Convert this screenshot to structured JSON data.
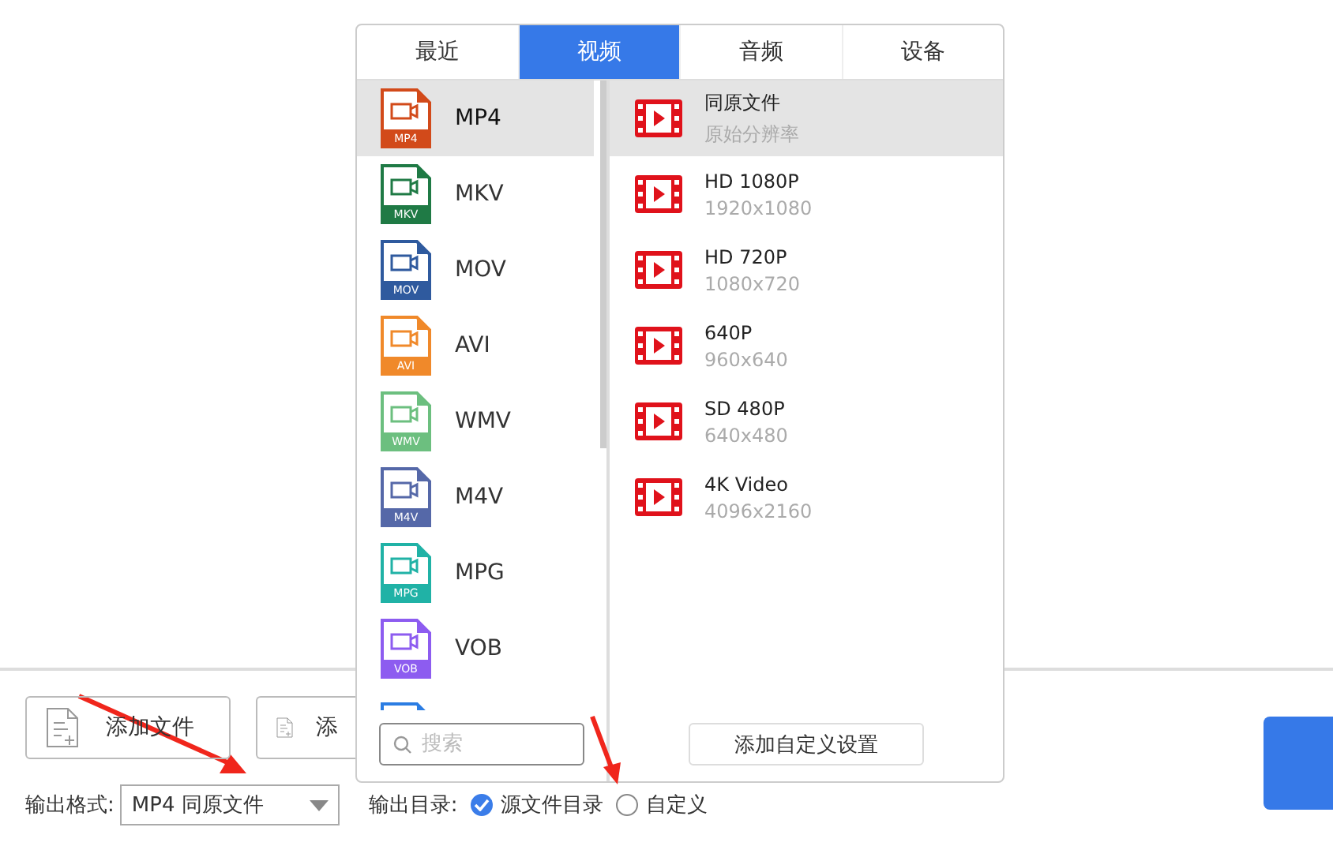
{
  "popup": {
    "tabs": [
      {
        "label": "最近",
        "selected": false
      },
      {
        "label": "视频",
        "selected": true
      },
      {
        "label": "音频",
        "selected": false
      },
      {
        "label": "设备",
        "selected": false
      }
    ],
    "formats": [
      {
        "name": "MP4",
        "badge": "MP4",
        "color": "#d24a1a",
        "selected": true
      },
      {
        "name": "MKV",
        "badge": "MKV",
        "color": "#1f7a45",
        "selected": false
      },
      {
        "name": "MOV",
        "badge": "MOV",
        "color": "#2f5a9e",
        "selected": false
      },
      {
        "name": "AVI",
        "badge": "AVI",
        "color": "#f0892a",
        "selected": false
      },
      {
        "name": "WMV",
        "badge": "WMV",
        "color": "#6cbf7f",
        "selected": false
      },
      {
        "name": "M4V",
        "badge": "M4V",
        "color": "#5568a8",
        "selected": false
      },
      {
        "name": "MPG",
        "badge": "MPG",
        "color": "#20b2a6",
        "selected": false
      },
      {
        "name": "VOB",
        "badge": "VOB",
        "color": "#8d5cf0",
        "selected": false
      },
      {
        "kind": "partial",
        "color": "#2b7de3",
        "selected": false
      }
    ],
    "search": {
      "placeholder": "搜索"
    },
    "presets": [
      {
        "title": "同原文件",
        "detail": "原始分辨率",
        "selected": true
      },
      {
        "title": "HD 1080P",
        "detail": "1920x1080",
        "selected": false
      },
      {
        "title": "HD 720P",
        "detail": "1080x720",
        "selected": false
      },
      {
        "title": "640P",
        "detail": "960x640",
        "selected": false
      },
      {
        "title": "SD 480P",
        "detail": "640x480",
        "selected": false
      },
      {
        "title": "4K Video",
        "detail": "4096x2160",
        "selected": false
      }
    ],
    "custom_button": "添加自定义设置"
  },
  "buttons": [
    {
      "label": "添加文件"
    },
    {
      "label": "添"
    }
  ],
  "output_format": {
    "label": "输出格式:",
    "value": "MP4 同原文件"
  },
  "output_dir": {
    "label": "输出目录:",
    "options": [
      {
        "label": "源文件目录",
        "selected": true
      },
      {
        "label": "自定义",
        "selected": false
      }
    ]
  }
}
